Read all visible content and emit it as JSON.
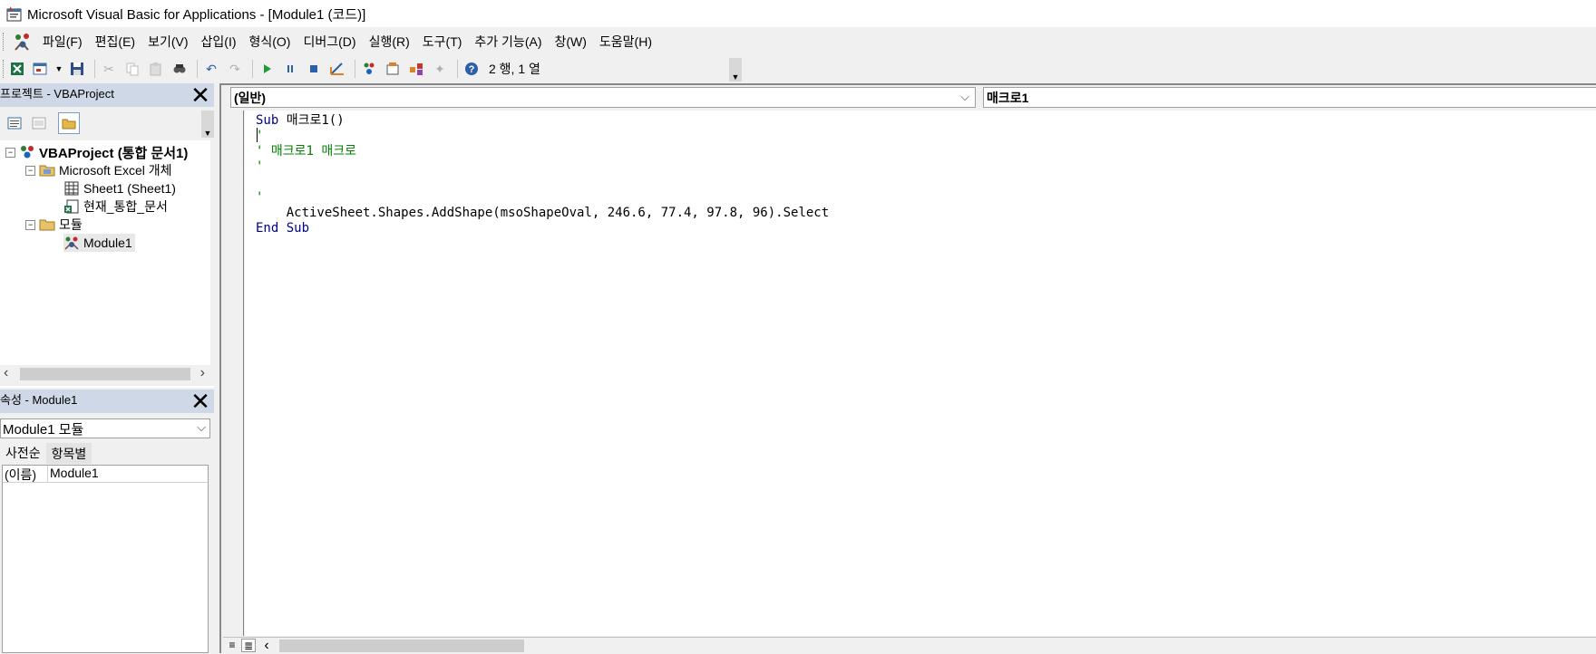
{
  "window": {
    "title": "Microsoft Visual Basic for Applications - [Module1 (코드)]"
  },
  "menu": {
    "items": [
      "파일(F)",
      "편집(E)",
      "보기(V)",
      "삽입(I)",
      "형식(O)",
      "디버그(D)",
      "실행(R)",
      "도구(T)",
      "추가 기능(A)",
      "창(W)",
      "도움말(H)"
    ]
  },
  "toolbar": {
    "position_status": "2 행, 1 열"
  },
  "project_pane": {
    "title": "프로젝트 - VBAProject",
    "tree": {
      "root": "VBAProject (통합 문서1)",
      "excel_objects_folder": "Microsoft Excel 개체",
      "sheet1": "Sheet1 (Sheet1)",
      "this_workbook": "현재_통합_문서",
      "modules_folder": "모듈",
      "module1": "Module1"
    }
  },
  "properties_pane": {
    "title": "속성 - Module1",
    "selected_object": "Module1 모듈",
    "tabs": [
      "사전순",
      "항목별"
    ],
    "rows": [
      {
        "name": "(이름)",
        "value": "Module1"
      }
    ]
  },
  "code_window": {
    "object_dropdown": "(일반)",
    "procedure_dropdown": "매크로1",
    "lines": [
      {
        "kw": "Sub",
        "text": " 매크로1()"
      },
      {
        "comment": "'"
      },
      {
        "comment": "' 매크로1 매크로"
      },
      {
        "comment": "'"
      },
      {
        "comment": ""
      },
      {
        "comment": "'"
      },
      {
        "text": "    ActiveSheet.Shapes.AddShape(msoShapeOval, 246.6, 77.4, 97.8, 96).Select"
      },
      {
        "kw": "End Sub",
        "text": ""
      }
    ]
  },
  "colors": {
    "keyword": "#00008b",
    "comment": "#008000",
    "pane_header": "#cfd8e6"
  }
}
